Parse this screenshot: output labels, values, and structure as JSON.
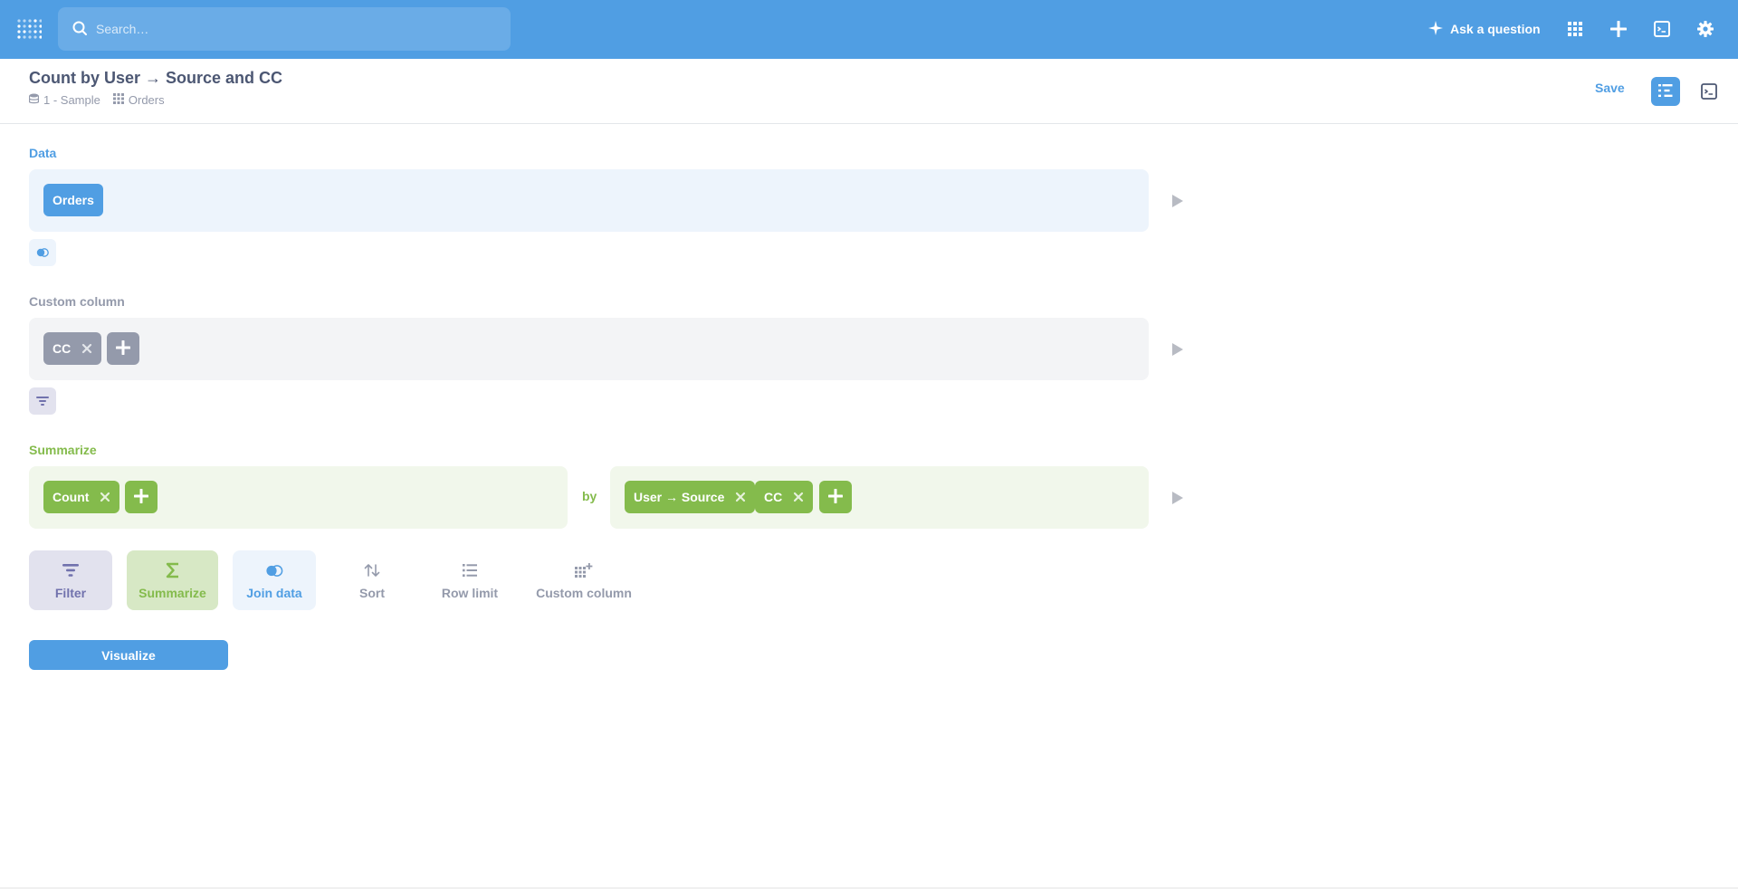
{
  "nav": {
    "search_placeholder": "Search…",
    "ask_label": "Ask a question",
    "icons": [
      "metabase-logo",
      "search-icon",
      "sparkle-icon",
      "grid-icon",
      "plus-icon",
      "sql-icon",
      "gear-icon"
    ]
  },
  "header": {
    "title": "Count by User → Source and CC",
    "database": "1 - Sample",
    "table": "Orders",
    "save_label": "Save"
  },
  "steps": {
    "data": {
      "label": "Data",
      "table": "Orders"
    },
    "custom_column": {
      "label": "Custom column",
      "columns": [
        "CC"
      ]
    },
    "summarize": {
      "label": "Summarize",
      "metrics": [
        "Count"
      ],
      "by_label": "by",
      "breakouts": [
        "User → Source",
        "CC"
      ]
    }
  },
  "actions": {
    "filter": "Filter",
    "summarize": "Summarize",
    "join": "Join data",
    "sort": "Sort",
    "row_limit": "Row limit",
    "custom_column": "Custom column"
  },
  "visualize_label": "Visualize",
  "colors": {
    "brand": "#509ee3",
    "summarize": "#84bb4c",
    "filter": "#7172ad",
    "custom_column": "#949aab",
    "data_bg": "#edf4fc",
    "custom_bg": "#f3f4f6",
    "summarize_bg": "#f1f7eb"
  }
}
